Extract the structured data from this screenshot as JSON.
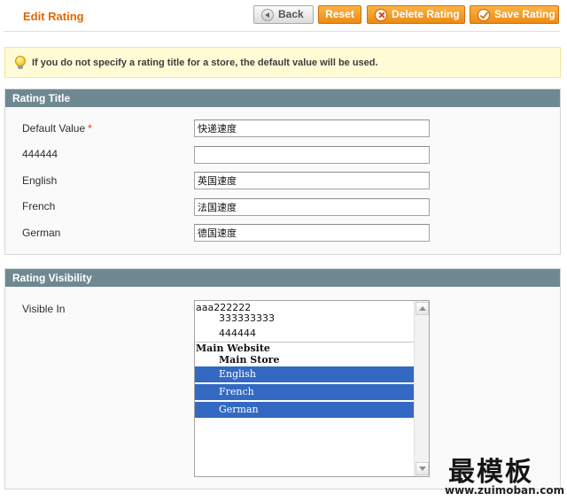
{
  "header": {
    "title": "Edit Rating",
    "back_label": "Back",
    "reset_label": "Reset",
    "delete_label": "Delete Rating",
    "save_label": "Save Rating"
  },
  "notice": {
    "text": "If you do not specify a rating title for a store, the default value will be used."
  },
  "rating_title": {
    "heading": "Rating Title",
    "fields": [
      {
        "label": "Default Value",
        "required": true,
        "value": "快递速度"
      },
      {
        "label": "444444",
        "required": false,
        "value": ""
      },
      {
        "label": "English",
        "required": false,
        "value": "英国速度"
      },
      {
        "label": "French",
        "required": false,
        "value": "法国速度"
      },
      {
        "label": "German",
        "required": false,
        "value": "德国速度"
      }
    ],
    "required_mark": "*"
  },
  "rating_visibility": {
    "heading": "Rating Visibility",
    "label": "Visible In",
    "options": [
      {
        "text": "aaa222222",
        "level": 0,
        "selected": false
      },
      {
        "text": "333333333",
        "level": 1,
        "selected": false
      },
      {
        "text": "444444",
        "level": 1,
        "selected": false
      },
      {
        "text": "Main Website",
        "level": 0,
        "selected": false
      },
      {
        "text": "Main Store",
        "level": 1,
        "selected": false
      },
      {
        "text": "English",
        "level": 1,
        "selected": true
      },
      {
        "text": "French",
        "level": 1,
        "selected": true
      },
      {
        "text": "German",
        "level": 1,
        "selected": true
      }
    ],
    "selection_color": "#3369c3"
  },
  "theme": {
    "accent": "#e26703",
    "button_orange": "#f0a020",
    "section_header": "#6f8992",
    "notice_bg": "#fffbd5"
  },
  "watermark": {
    "brand": "最模板",
    "url": "www.zuimoban.com"
  }
}
